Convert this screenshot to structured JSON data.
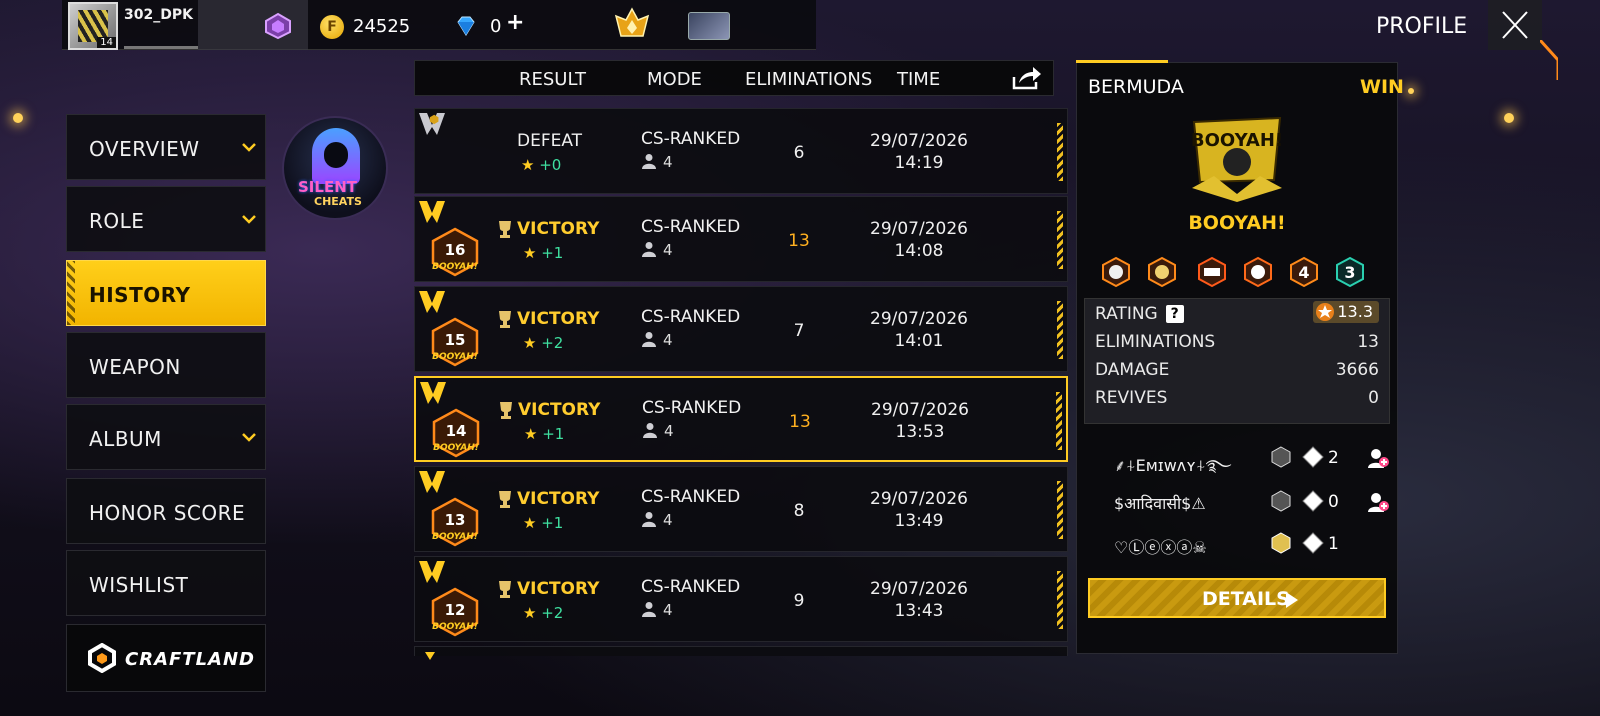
{
  "header": {
    "username": "302_DPK",
    "level": "14",
    "coins": "24525",
    "diamonds": "0",
    "plus": "+",
    "page_title": "PROFILE"
  },
  "menu": {
    "items": [
      {
        "label": "OVERVIEW",
        "has_chevron": true
      },
      {
        "label": "ROLE",
        "has_chevron": true
      },
      {
        "label": "HISTORY",
        "active": true
      },
      {
        "label": "WEAPON"
      },
      {
        "label": "ALBUM",
        "has_chevron": true
      },
      {
        "label": "HONOR SCORE"
      },
      {
        "label": "WISHLIST"
      }
    ],
    "craftland": "CRAFTLAND"
  },
  "promo_avatar": {
    "line1": "SILENT",
    "line2": "CHEATS"
  },
  "table": {
    "headers": {
      "result": "RESULT",
      "mode": "MODE",
      "eliminations": "ELIMINATIONS",
      "time": "TIME"
    },
    "rows": [
      {
        "result": "DEFEAT",
        "star": "★",
        "points": "+0",
        "mode": "CS-RANKED",
        "players": "4",
        "eliminations": "6",
        "date": "29/07/2026",
        "time": "14:19",
        "booyah_number": ""
      },
      {
        "result": "VICTORY",
        "star": "★",
        "points": "+1",
        "mode": "CS-RANKED",
        "players": "4",
        "eliminations": "13",
        "date": "29/07/2026",
        "time": "14:08",
        "booyah_number": "16"
      },
      {
        "result": "VICTORY",
        "star": "★",
        "points": "+2",
        "mode": "CS-RANKED",
        "players": "4",
        "eliminations": "7",
        "date": "29/07/2026",
        "time": "14:01",
        "booyah_number": "15"
      },
      {
        "result": "VICTORY",
        "star": "★",
        "points": "+1",
        "mode": "CS-RANKED",
        "players": "4",
        "eliminations": "13",
        "date": "29/07/2026",
        "time": "13:53",
        "booyah_number": "14"
      },
      {
        "result": "VICTORY",
        "star": "★",
        "points": "+1",
        "mode": "CS-RANKED",
        "players": "4",
        "eliminations": "8",
        "date": "29/07/2026",
        "time": "13:49",
        "booyah_number": "13"
      },
      {
        "result": "VICTORY",
        "star": "★",
        "points": "+2",
        "mode": "CS-RANKED",
        "players": "4",
        "eliminations": "9",
        "date": "29/07/2026",
        "time": "13:43",
        "booyah_number": "12"
      }
    ],
    "booyah_badge_text": "BOOYAH!",
    "selected_row": 3
  },
  "detail": {
    "map": "BERMUDA",
    "outcome": "WIN",
    "logo_text": "BOOYAH!",
    "title": "BOOYAH!",
    "medal_numbers": [
      "4",
      "3"
    ],
    "stats": {
      "rating_label": "RATING",
      "rating_help": "?",
      "rating_value": "13.3",
      "eliminations_label": "ELIMINATIONS",
      "eliminations_value": "13",
      "damage_label": "DAMAGE",
      "damage_value": "3666",
      "revives_label": "REVIVES",
      "revives_value": "0"
    },
    "teammates": [
      {
        "name": "⸙⍭Eᴍɪᴡᴧʏ⍭࿐",
        "count": "2"
      },
      {
        "name": "$आदिवासी$⚠",
        "count": "0"
      },
      {
        "name": "♡Ⓛⓔⓧⓐ☠",
        "count": "1"
      }
    ],
    "details_button": "DETAILS"
  },
  "colors": {
    "accent": "#ffcc22",
    "positive_points": "#3fe0a0",
    "high_elims": "#ffb020"
  }
}
